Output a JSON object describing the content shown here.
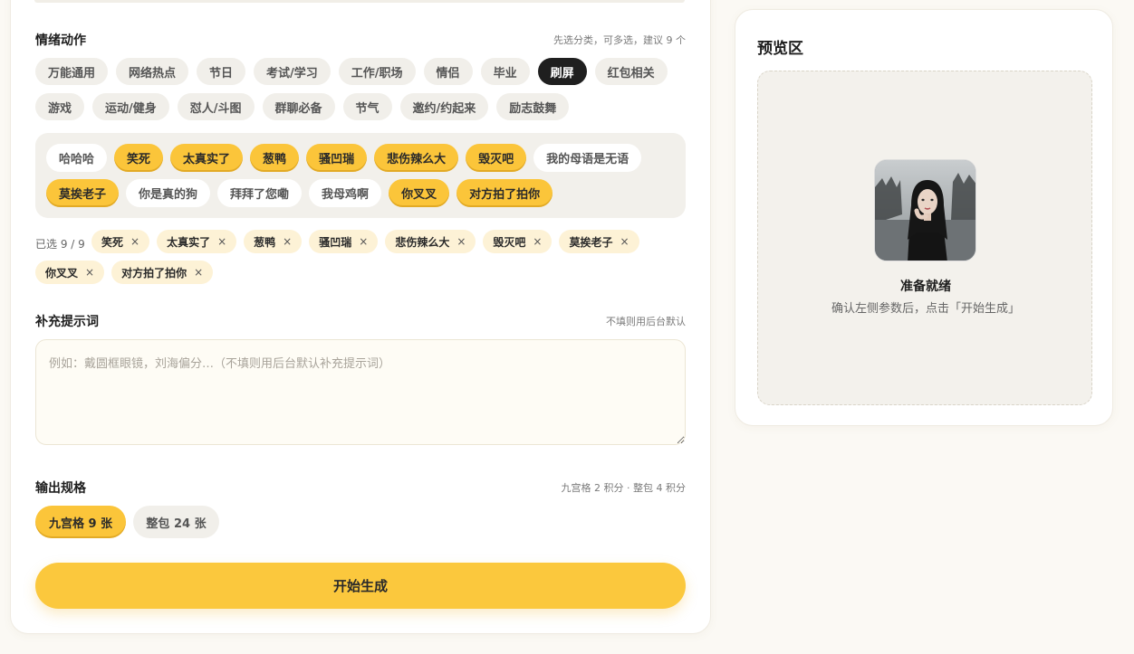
{
  "emotion_section": {
    "title": "情绪动作",
    "hint": "先选分类，可多选，建议 9 个",
    "categories_row1": [
      {
        "label": "万能通用",
        "active": false
      },
      {
        "label": "网络热点",
        "active": false
      },
      {
        "label": "节日",
        "active": false
      },
      {
        "label": "考试/学习",
        "active": false
      },
      {
        "label": "工作/职场",
        "active": false
      },
      {
        "label": "情侣",
        "active": false
      },
      {
        "label": "毕业",
        "active": false
      },
      {
        "label": "刷屏",
        "active": true
      },
      {
        "label": "红包相关",
        "active": false
      }
    ],
    "categories_row2": [
      {
        "label": "游戏",
        "active": false
      },
      {
        "label": "运动/健身",
        "active": false
      },
      {
        "label": "怼人/斗图",
        "active": false
      },
      {
        "label": "群聊必备",
        "active": false
      },
      {
        "label": "节气",
        "active": false
      },
      {
        "label": "邀约/约起来",
        "active": false
      },
      {
        "label": "励志鼓舞",
        "active": false
      }
    ],
    "phrases_row1": [
      {
        "label": "哈哈哈",
        "selected": false
      },
      {
        "label": "笑死",
        "selected": true
      },
      {
        "label": "太真实了",
        "selected": true
      },
      {
        "label": "葱鸭",
        "selected": true
      },
      {
        "label": "骚凹瑞",
        "selected": true
      },
      {
        "label": "悲伤辣么大",
        "selected": true
      },
      {
        "label": "毁灭吧",
        "selected": true
      },
      {
        "label": "我的母语是无语",
        "selected": false
      }
    ],
    "phrases_row2": [
      {
        "label": "莫挨老子",
        "selected": true
      },
      {
        "label": "你是真的狗",
        "selected": false
      },
      {
        "label": "拜拜了您嘞",
        "selected": false
      },
      {
        "label": "我母鸡啊",
        "selected": false
      },
      {
        "label": "你叉叉",
        "selected": true
      },
      {
        "label": "对方拍了拍你",
        "selected": true
      }
    ],
    "selected_label": "已选 9 / 9",
    "selected_row1": [
      "笑死",
      "太真实了",
      "葱鸭",
      "骚凹瑞",
      "悲伤辣么大",
      "毁灭吧",
      "莫挨老子"
    ],
    "selected_row2": [
      "你叉叉",
      "对方拍了拍你"
    ],
    "remove_glyph": "×"
  },
  "prompt_section": {
    "title": "补充提示词",
    "hint": "不填则用后台默认",
    "placeholder": "例如：戴圆框眼镜，刘海偏分…（不填则用后台默认补充提示词）",
    "value": ""
  },
  "output_section": {
    "title": "输出规格",
    "hint": "九宫格 2 积分 · 整包 4 积分",
    "option_grid": "九宫格 9 张",
    "option_pack": "整包 24 张",
    "selected": "grid"
  },
  "generate_button": "开始生成",
  "preview": {
    "title": "预览区",
    "status_title": "准备就绪",
    "status_desc": "确认左侧参数后，点击「开始生成」"
  },
  "colors": {
    "accent": "#fbc53a",
    "active_chip": "#1f1f1f",
    "tag_bg": "#fdf2d6"
  }
}
